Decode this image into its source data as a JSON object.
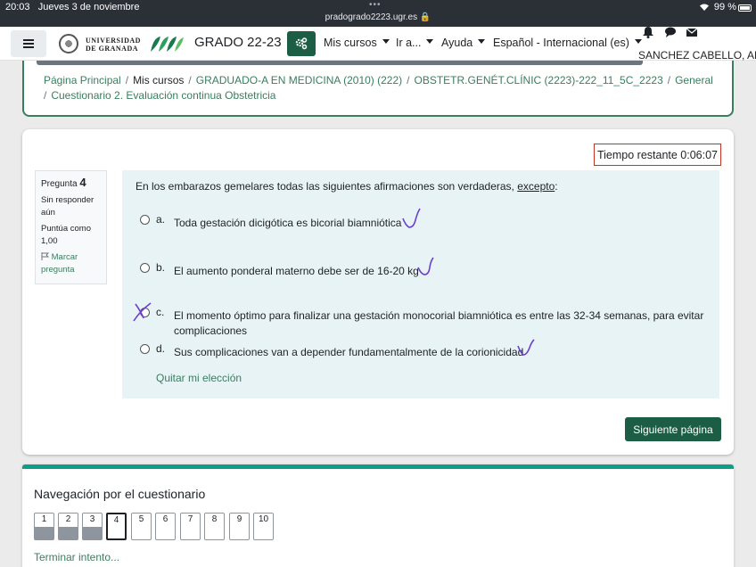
{
  "status_bar": {
    "time": "20:03",
    "date": "Jueves 3 de noviembre",
    "url": "pradogrado2223.ugr.es",
    "battery": "99 %"
  },
  "navbar": {
    "logo_text_line1": "UNIVERSIDAD",
    "logo_text_line2": "DE GRANADA",
    "brand": "GRADO 22-23",
    "menu": [
      "Mis cursos",
      "Ir a...",
      "Ayuda",
      "Español - Internacional (es)"
    ],
    "user_name": "SANCHEZ CABELLO, ANT"
  },
  "breadcrumb": {
    "items": [
      "Página Principal",
      "Mis cursos",
      "GRADUADO-A EN MEDICINA (2010) (222)",
      "OBSTETR.GENÉT.CLÍNIC (2223)-222_11_5C_2223",
      "General",
      "Cuestionario 2. Evaluación continua Obstetricia"
    ]
  },
  "timer": "Tiempo restante 0:06:07",
  "question_info": {
    "label": "Pregunta",
    "number": "4",
    "status": "Sin responder aún",
    "score": "Puntúa como 1,00",
    "flag": "Marcar pregunta"
  },
  "question": {
    "stem": "En los embarazos gemelares todas las siguientes afirmaciones son verdaderas, ",
    "stem_emph": "excepto",
    "stem_end": ":",
    "options": [
      {
        "letter": "a.",
        "text": "Toda gestación dicigótica es bicorial biamniótica"
      },
      {
        "letter": "b.",
        "text": "El aumento ponderal materno debe ser de 16-20 kg"
      },
      {
        "letter": "c.",
        "text": "El momento óptimo para finalizar una gestación monocorial biamniótica es entre las 32-34 semanas, para evitar complicaciones"
      },
      {
        "letter": "d.",
        "text": "Sus complicaciones van a depender fundamentalmente de la corionicidad"
      }
    ],
    "clear_choice": "Quitar mi elección"
  },
  "next_button": "Siguiente página",
  "quiz_navigation": {
    "title": "Navegación por el cuestionario",
    "buttons": [
      "1",
      "2",
      "3",
      "4",
      "5",
      "6",
      "7",
      "8",
      "9",
      "10"
    ],
    "finish": "Terminar intento..."
  },
  "colors": {
    "brand_green": "#1b5e45",
    "link_green": "#3a7d5f",
    "timer_border": "#ca3120",
    "annotation_ink": "#6b3fd0"
  }
}
